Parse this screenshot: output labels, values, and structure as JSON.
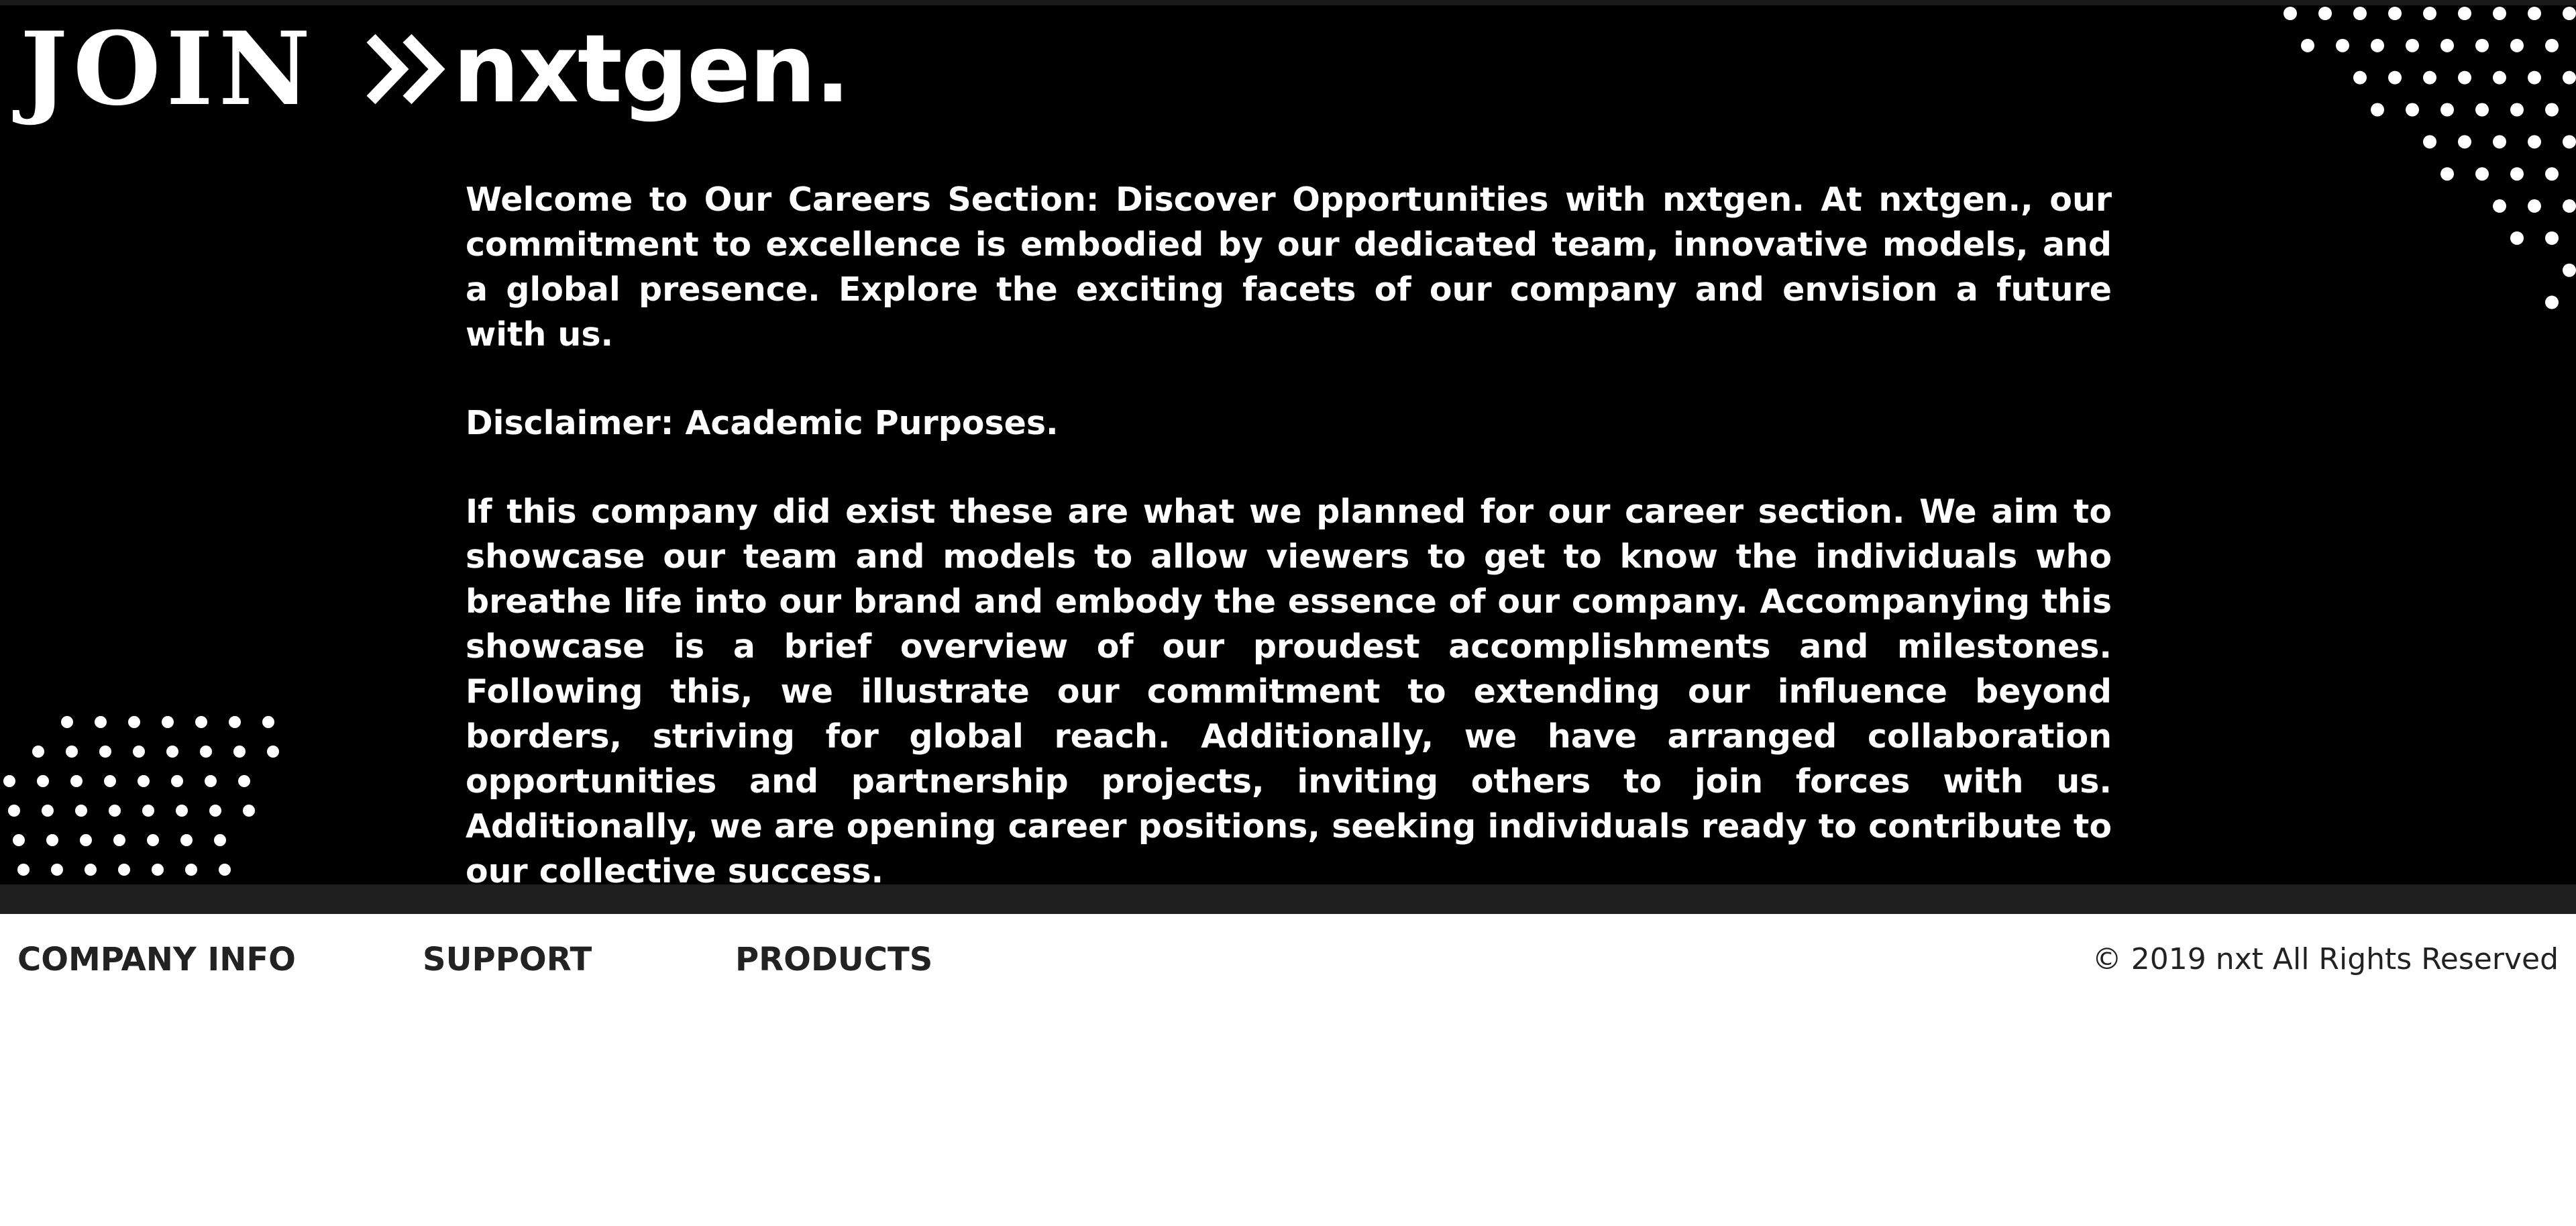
{
  "header": {
    "join_text": "JOIN",
    "chevron_icon": "double-chevron-right-icon",
    "brand_text": "nxtgen."
  },
  "content": {
    "intro": "Welcome to Our Careers Section: Discover Opportunities with nxtgen. At nxtgen., our commitment to excellence is embodied by our dedicated team, innovative models, and a global presence. Explore the exciting facets of our company and envision a future with us.",
    "disclaimer": "Disclaimer: Academic Purposes.",
    "body": "If this company did exist these are what we planned for our career section. We aim to showcase our team and models to allow viewers to get to know the individuals who breathe life into our brand and embody the essence of our company. Accompanying this showcase is a brief overview of our proudest accomplishments and milestones. Following this, we illustrate our commitment to extending our influence beyond borders, striving for global reach. Additionally, we have arranged collaboration opportunities and partnership projects, inviting others to join forces with us. Additionally, we are opening career positions, seeking individuals ready to contribute to our collective success."
  },
  "footer": {
    "links": [
      "COMPANY INFO",
      "SUPPORT",
      "PRODUCTS"
    ],
    "copyright": "© 2019 nxt All Rights Reserved"
  },
  "colors": {
    "hero_background": "#000000",
    "hero_text": "#ffffff",
    "footer_background": "#ffffff",
    "footer_text": "#222222"
  }
}
